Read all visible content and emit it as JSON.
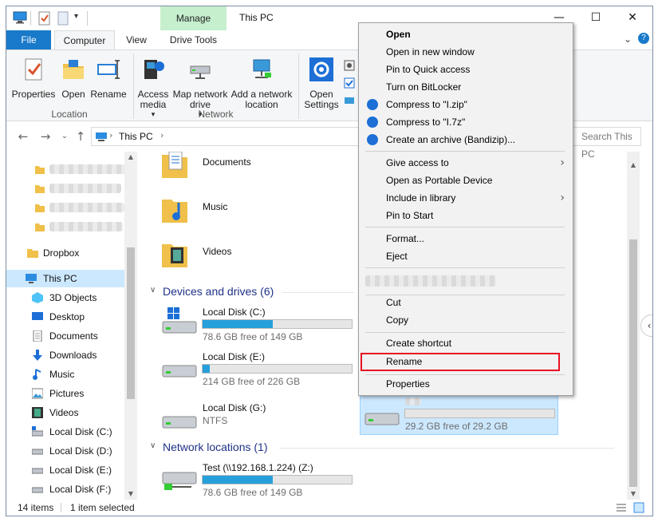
{
  "window": {
    "title": "This PC",
    "manage_tab": "Manage"
  },
  "ribbon_tabs": {
    "file": "File",
    "computer": "Computer",
    "view": "View",
    "drive_tools": "Drive Tools"
  },
  "ribbon": {
    "properties": "Properties",
    "open": "Open",
    "rename": "Rename",
    "access_media": "Access media",
    "map_network_drive": "Map network drive",
    "add_network_location": "Add a network location",
    "open_settings": "Open Settings",
    "group_location": "Location",
    "group_network": "Network"
  },
  "address": {
    "path": "This PC",
    "search_placeholder": "Search This PC"
  },
  "nav": {
    "dropbox": "Dropbox",
    "this_pc": "This PC",
    "objects3d": "3D Objects",
    "desktop": "Desktop",
    "documents": "Documents",
    "downloads": "Downloads",
    "music": "Music",
    "pictures": "Pictures",
    "videos": "Videos",
    "local_c": "Local Disk (C:)",
    "local_d": "Local Disk (D:)",
    "local_e": "Local Disk (E:)",
    "local_f": "Local Disk (F:)"
  },
  "content": {
    "folders": {
      "documents": "Documents",
      "music": "Music",
      "videos": "Videos"
    },
    "devices_header": "Devices and drives (6)",
    "drives": [
      {
        "name": "Local Disk (C:)",
        "sub": "78.6 GB free of 149 GB",
        "used_fraction": 0.47
      },
      {
        "name": "Local Disk (E:)",
        "sub": "214 GB free of 226 GB",
        "used_fraction": 0.05
      },
      {
        "name": "Local Disk (G:)",
        "sub": "NTFS"
      },
      {
        "name": "",
        "sub": "29.2 GB free of 29.2 GB",
        "used_fraction": 0.0
      }
    ],
    "network_header": "Network locations (1)",
    "network": {
      "name": "Test (\\\\192.168.1.224) (Z:)",
      "sub": "78.6 GB free of 149 GB",
      "used_fraction": 0.47
    }
  },
  "status": {
    "items": "14 items",
    "selected": "1 item selected"
  },
  "menu": {
    "open": "Open",
    "open_new_window": "Open in new window",
    "pin_quick": "Pin to Quick access",
    "bitlocker": "Turn on BitLocker",
    "compress_zip": "Compress to \"I.zip\"",
    "compress_7z": "Compress to \"I.7z\"",
    "create_archive": "Create an archive (Bandizip)...",
    "give_access": "Give access to",
    "portable": "Open as Portable Device",
    "include_library": "Include in library",
    "pin_start": "Pin to Start",
    "format": "Format...",
    "eject": "Eject",
    "cut": "Cut",
    "copy": "Copy",
    "create_shortcut": "Create shortcut",
    "rename": "Rename",
    "properties": "Properties"
  },
  "colors": {
    "accent": "#1979ca",
    "manage": "#c6efce",
    "highlight": "#e81123",
    "fill": "#26a0da"
  }
}
